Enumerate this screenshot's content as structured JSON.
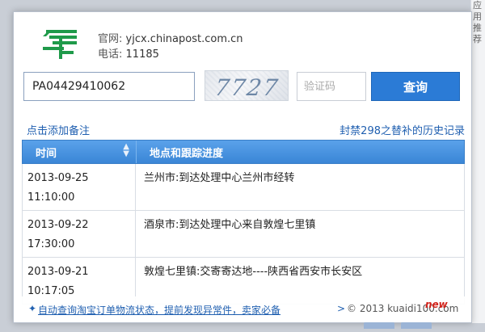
{
  "side_text": "应用推荐",
  "contact": {
    "website_label": "官网:",
    "website": "yjcx.chinapost.com.cn",
    "phone_label": "电话:",
    "phone": "11185"
  },
  "tracking_number": "PA04429410062",
  "captcha_text": "7727",
  "verify_placeholder": "验证码",
  "query_button": "查询",
  "add_note_link": "点击添加备注",
  "history_link": "封禁298之替补的历史记录",
  "table": {
    "col_time": "时间",
    "col_location": "地点和跟踪进度",
    "rows": [
      {
        "date": "2013-09-25",
        "time": "11:10:00",
        "desc": "兰州市:到达处理中心兰州市经转"
      },
      {
        "date": "2013-09-22",
        "time": "17:30:00",
        "desc": "酒泉市:到达处理中心来自敦煌七里镇"
      },
      {
        "date": "2013-09-21",
        "time": "10:17:05",
        "desc": "敦煌七里镇:交寄寄达地----陕西省西安市长安区"
      }
    ]
  },
  "footer": {
    "link_text": "自动查询淘宝订单物流状态，提前发现异常件，卖家必备",
    "arrow": ">",
    "copyright": "© 2013 kuaidi100.com"
  },
  "new_badge": "new",
  "colors": {
    "accent": "#2b7bd6",
    "header": "#3a86d6",
    "link": "#1f5fb0",
    "logo": "#1f9a4a"
  }
}
